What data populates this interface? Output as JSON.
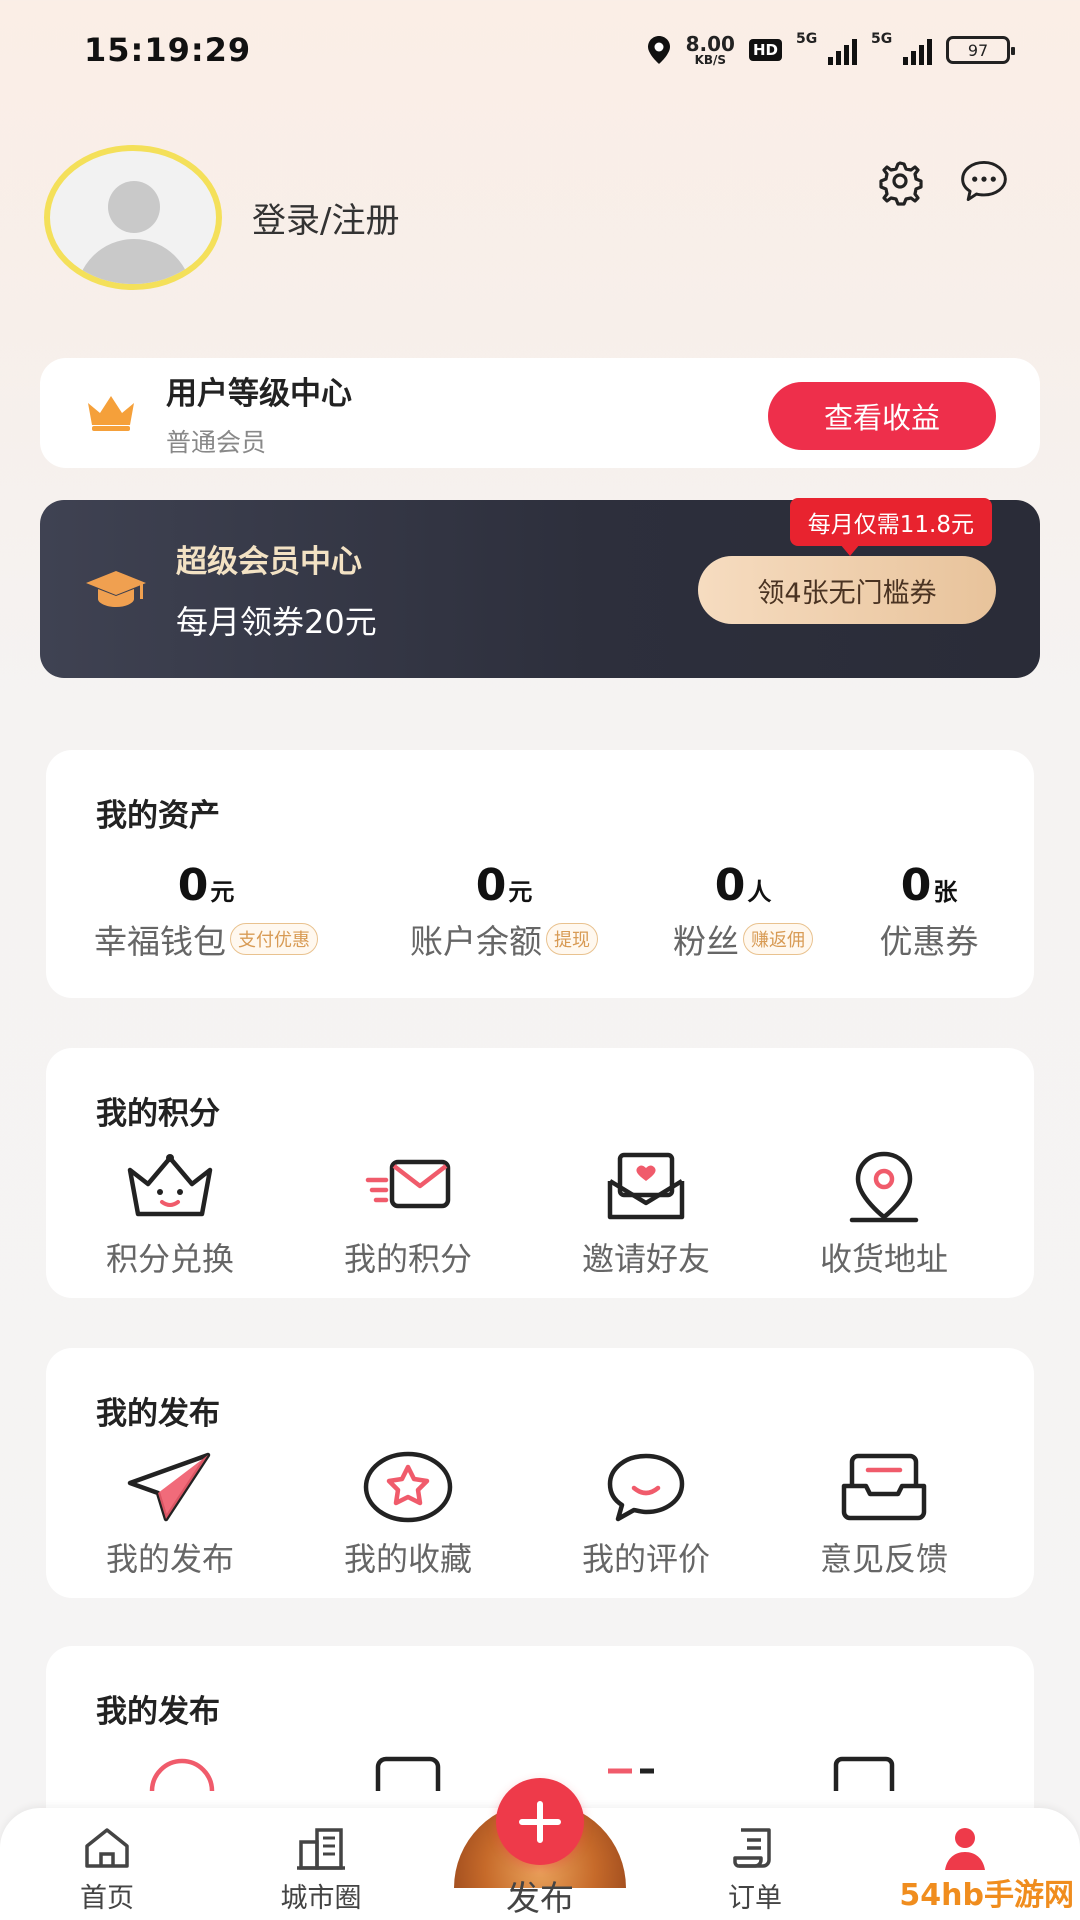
{
  "status_bar": {
    "time": "15:19:29",
    "net_speed": "8.00",
    "net_unit": "KB/S",
    "hd": "HD",
    "sig1": "5G",
    "sig2": "5G",
    "battery": "97"
  },
  "profile": {
    "login_text": "登录/注册"
  },
  "level_card": {
    "title": "用户等级中心",
    "subtitle": "普通会员",
    "button": "查看收益"
  },
  "vip_card": {
    "title": "超级会员中心",
    "subtitle": "每月领券20元",
    "promo": "每月仅需11.8元",
    "button": "领4张无门槛券"
  },
  "assets": {
    "title": "我的资产",
    "items": [
      {
        "value": "0",
        "unit": "元",
        "name": "幸福钱包",
        "tag": "支付优惠"
      },
      {
        "value": "0",
        "unit": "元",
        "name": "账户余额",
        "tag": "提现"
      },
      {
        "value": "0",
        "unit": "人",
        "name": "粉丝",
        "tag": "赚返佣"
      },
      {
        "value": "0",
        "unit": "张",
        "name": "优惠券",
        "tag": ""
      }
    ]
  },
  "points": {
    "title": "我的积分",
    "items": [
      {
        "label": "积分兑换",
        "icon": "crown-smile-icon"
      },
      {
        "label": "我的积分",
        "icon": "mail-fast-icon"
      },
      {
        "label": "邀请好友",
        "icon": "heart-letter-icon"
      },
      {
        "label": "收货地址",
        "icon": "location-pin-icon"
      }
    ]
  },
  "publish": {
    "title": "我的发布",
    "items": [
      {
        "label": "我的发布",
        "icon": "paper-plane-icon"
      },
      {
        "label": "我的收藏",
        "icon": "star-icon"
      },
      {
        "label": "我的评价",
        "icon": "chat-smile-icon"
      },
      {
        "label": "意见反馈",
        "icon": "inbox-icon"
      }
    ]
  },
  "publish2": {
    "title": "我的发布"
  },
  "nav": {
    "home": "首页",
    "city": "城市圈",
    "publish": "发布",
    "orders": "订单"
  },
  "watermark": "54hb手游网",
  "colors": {
    "accent_red": "#ee2f4b",
    "vip_bg": "#2d2f3c",
    "gold": "#e8c39b",
    "avatar_ring": "#f4e05a"
  }
}
